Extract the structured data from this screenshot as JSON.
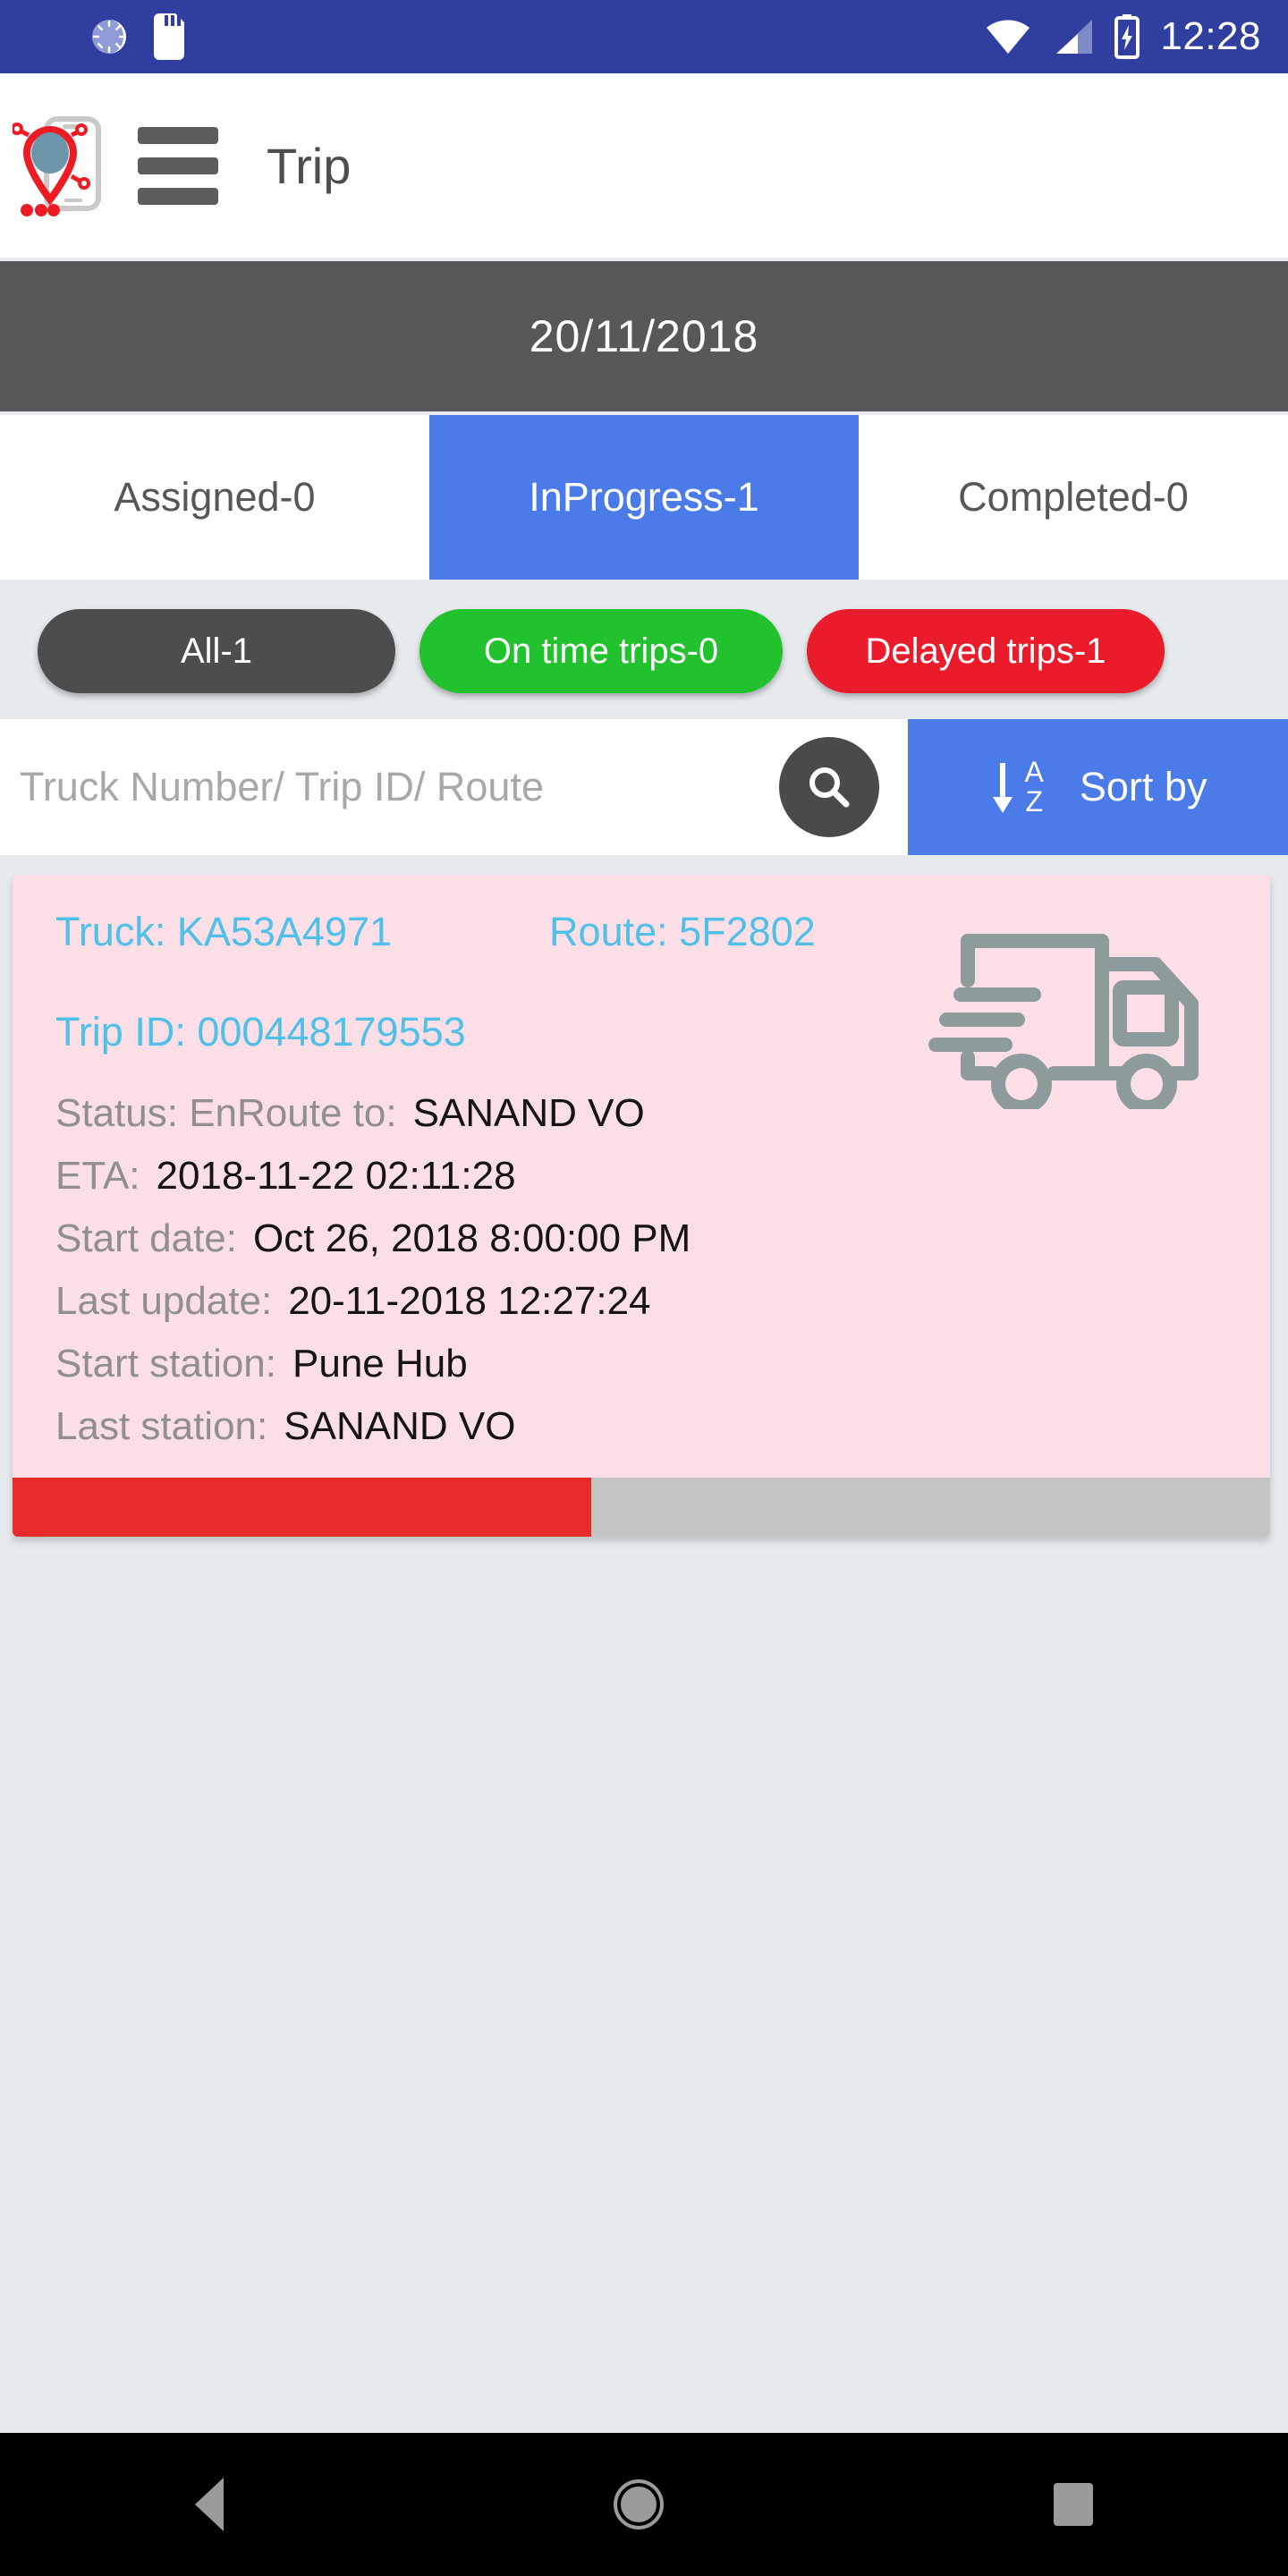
{
  "statusbar": {
    "time": "12:28",
    "icons": [
      "sync-spinner-icon",
      "sd-card-icon",
      "wifi-icon",
      "cellular-signal-icon",
      "battery-charging-icon"
    ]
  },
  "appbar": {
    "logo_name": "app-logo-tracker",
    "menu_name": "hamburger-menu",
    "title": "Trip"
  },
  "datebar": {
    "date": "20/11/2018"
  },
  "tabs": [
    {
      "label": "Assigned-0",
      "active": false
    },
    {
      "label": "InProgress-1",
      "active": true
    },
    {
      "label": "Completed-0",
      "active": false
    }
  ],
  "filters": [
    {
      "label": "All-1",
      "color": "#4d4d4d"
    },
    {
      "label": "On time trips-0",
      "color": "#22c22e"
    },
    {
      "label": "Delayed trips-1",
      "color": "#ea1b2b"
    }
  ],
  "search": {
    "placeholder": "Truck Number/ Trip ID/ Route",
    "value": "",
    "sort_label": "Sort by",
    "sort_icon_top": "A",
    "sort_icon_bottom": "Z"
  },
  "trip_card": {
    "truck_label": "Truck: KA53A4971",
    "route_label": "Route: 5F2802",
    "trip_id_label": "Trip ID: 000448179553",
    "rows": [
      {
        "label": "Status: EnRoute to:",
        "value": "SANAND VO"
      },
      {
        "label": "ETA:",
        "value": "2018-11-22 02:11:28"
      },
      {
        "label": "Start date:",
        "value": "Oct 26, 2018 8:00:00 PM"
      },
      {
        "label": "Last update:",
        "value": "20-11-2018 12:27:24"
      },
      {
        "label": "Start station:",
        "value": "Pune Hub"
      },
      {
        "label": "Last station:",
        "value": "SANAND VO"
      }
    ],
    "progress_percent": 46,
    "progress_color": "#ea2929",
    "track_color": "#c4c4c4",
    "card_background": "#fcdee7",
    "accent_color": "#4fc0e8"
  },
  "navbar": {
    "back": "back-nav-button",
    "home": "home-nav-button",
    "recent": "recent-apps-button"
  }
}
